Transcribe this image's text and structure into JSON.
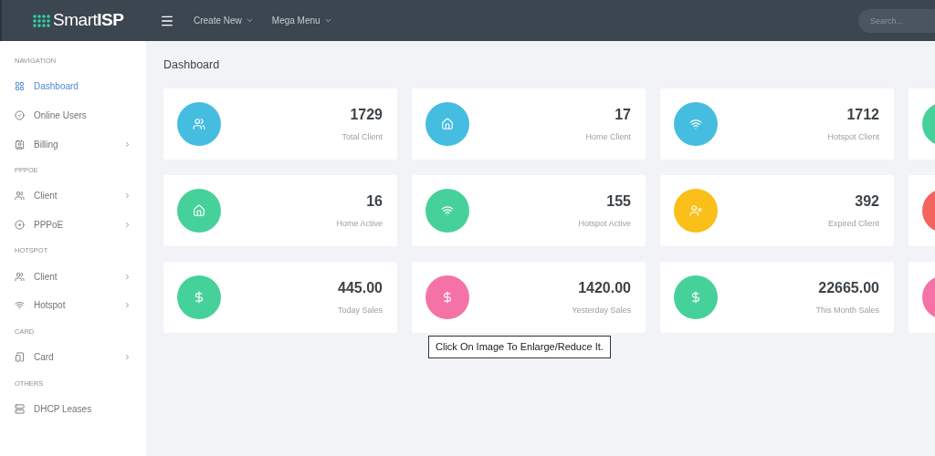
{
  "topbar": {
    "logo_text": "Smart",
    "logo_bold": "ISP",
    "menus": [
      {
        "label": "Create New"
      },
      {
        "label": "Mega Menu"
      }
    ],
    "search": {
      "placeholder": "Search..."
    }
  },
  "sidebar": {
    "sections": [
      {
        "title": "NAVIGATION",
        "items": [
          {
            "label": "Dashboard",
            "kind": "grid",
            "selected": true,
            "submenu": false
          },
          {
            "label": "Online Users",
            "kind": "check",
            "selected": false,
            "submenu": false
          },
          {
            "label": "Billing",
            "kind": "billing",
            "selected": false,
            "submenu": true
          }
        ]
      },
      {
        "title": "PPPOE",
        "items": [
          {
            "label": "Client",
            "kind": "users",
            "selected": false,
            "submenu": true
          },
          {
            "label": "PPPoE",
            "kind": "target",
            "selected": false,
            "submenu": true
          }
        ]
      },
      {
        "title": "HOTSPOT",
        "items": [
          {
            "label": "Client",
            "kind": "users",
            "selected": false,
            "submenu": true
          },
          {
            "label": "Hotspot",
            "kind": "wifi",
            "selected": false,
            "submenu": true
          }
        ]
      },
      {
        "title": "CARD",
        "items": [
          {
            "label": "Card",
            "kind": "card",
            "selected": false,
            "submenu": true
          }
        ]
      },
      {
        "title": "OTHERS",
        "items": [
          {
            "label": "DHCP Leases",
            "kind": "server",
            "selected": false,
            "submenu": false
          }
        ]
      }
    ]
  },
  "page_title": "Dashboard",
  "stat_rows": [
    [
      {
        "value": "1729",
        "label": "Total Client",
        "kind": "users",
        "color": "#45bde0"
      },
      {
        "value": "17",
        "label": "Home Client",
        "kind": "home",
        "color": "#45bde0"
      },
      {
        "value": "1712",
        "label": "Hotspot Client",
        "kind": "wifi",
        "color": "#45bde0"
      },
      {
        "color": "#47d19a"
      }
    ],
    [
      {
        "value": "16",
        "label": "Home Active",
        "kind": "home",
        "color": "#47d19a"
      },
      {
        "value": "155",
        "label": "Hotspot Active",
        "kind": "wifi",
        "color": "#47d19a"
      },
      {
        "value": "392",
        "label": "Expired Client",
        "kind": "user-x",
        "color": "#fbbf1a"
      },
      {
        "color": "#f4645f"
      }
    ],
    [
      {
        "value": "445.00",
        "label": "Today Sales",
        "kind": "dollar",
        "color": "#47d19a"
      },
      {
        "value": "1420.00",
        "label": "Yesterday Sales",
        "kind": "dollar",
        "color": "#f572a6"
      },
      {
        "value": "22665.00",
        "label": "This Month Sales",
        "kind": "dollar",
        "color": "#47d19a"
      },
      {
        "color": "#f572a6"
      }
    ]
  ],
  "tooltip": "Click On Image To Enlarge/Reduce It."
}
